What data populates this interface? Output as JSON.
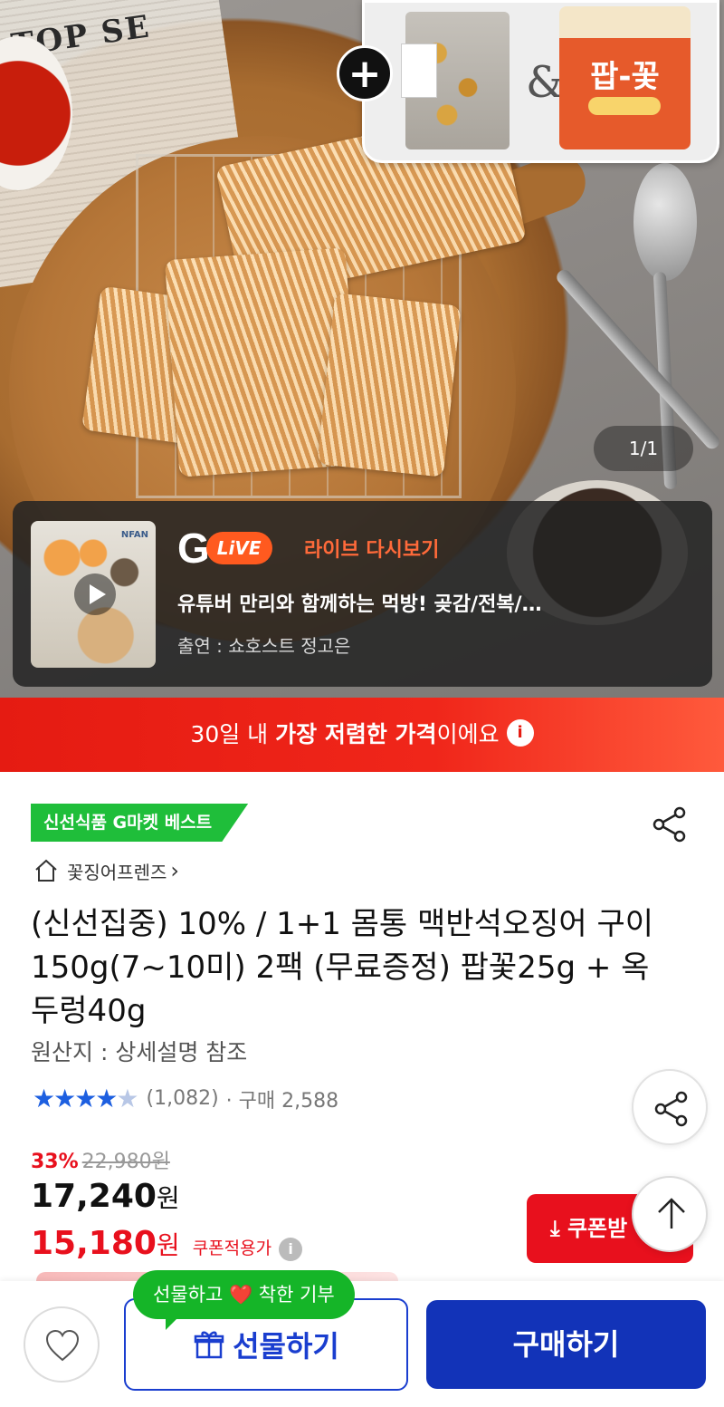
{
  "hero": {
    "page_indicator": "1/1",
    "newspaper_text": "TOP SE",
    "inset_plus": "+",
    "inset_amp": "&",
    "inset_bag2_title": "팝-꽃"
  },
  "live": {
    "logo_g": "G",
    "logo_live": "LiVE",
    "replay_label": "라이브 다시보기",
    "title": "유튜버 만리와 함께하는 먹방! 곶감/전복/…",
    "cast": "출연 : 쇼호스트 정고은",
    "thumb_brand": "NFAN"
  },
  "promo": {
    "prefix": "30일 내 ",
    "highlight": "가장 저렴한 가격",
    "suffix": "이에요",
    "info_icon": "i"
  },
  "product": {
    "badge": "신선식품 G마켓 베스트",
    "shop_name": "꽃징어프렌즈",
    "shop_chevron": "›",
    "title": "(신선집중) 10% / 1+1 몸통 맥반석오징어 구이 150g(7~10미) 2팩 (무료증정) 팝꽃25g + 옥두렁40g",
    "origin": "원산지 : 상세설명 참조",
    "stars": "★★★★",
    "half_star": "★",
    "review_count": "(1,082)",
    "buy_count": "· 구매 2,588",
    "discount_rate": "33%",
    "original_price": "22,980원",
    "sale_price": "17,240",
    "coupon_price": "15,180",
    "won": "원",
    "coupon_note": "쿠폰적용가",
    "coupon_info": "i",
    "coupon_button": "⤓ 쿠폰받"
  },
  "bottom": {
    "gift_tooltip_prefix": "선물하고 ",
    "gift_tooltip_heart": "❤️",
    "gift_tooltip_suffix": " 착한 기부",
    "gift_label": "선물하기",
    "buy_label": "구매하기"
  },
  "colors": {
    "brand_red": "#e8101d",
    "brand_blue": "#1233b8",
    "badge_green": "#1fbe3a",
    "star_blue": "#1d5fe0"
  }
}
